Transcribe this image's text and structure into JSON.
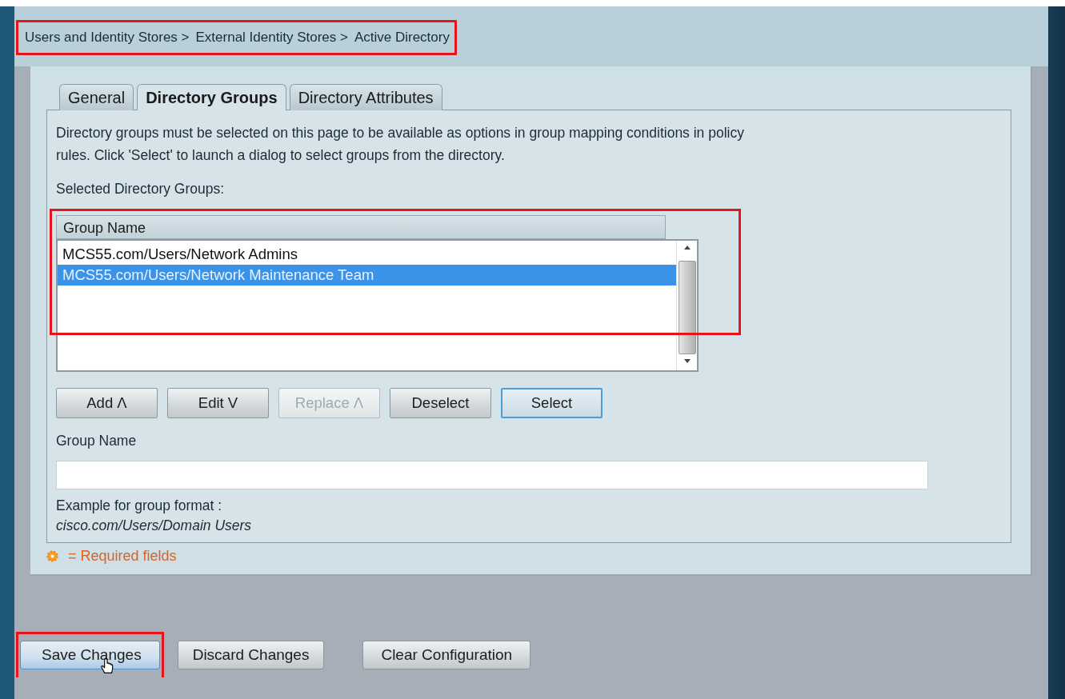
{
  "breadcrumb": {
    "items": [
      "Users and Identity Stores >",
      "External Identity Stores >",
      "Active Directory"
    ],
    "highlighted": true
  },
  "tabs": [
    {
      "label": "General",
      "selected": false
    },
    {
      "label": "Directory Groups",
      "selected": true
    },
    {
      "label": "Directory Attributes",
      "selected": false
    }
  ],
  "description": "Directory groups must be selected on this page to be available as options in group mapping conditions in policy rules. Click 'Select' to launch a dialog to select groups from the directory.",
  "selected_groups_label": "Selected Directory Groups:",
  "group_list": {
    "column": "Group Name",
    "highlighted": true,
    "rows": [
      {
        "text": "MCS55.com/Users/Network Admins",
        "selected": false
      },
      {
        "text": "MCS55.com/Users/Network Maintenance Team",
        "selected": true
      }
    ]
  },
  "list_buttons": [
    {
      "label": "Add Λ",
      "disabled": false,
      "focused": false
    },
    {
      "label": "Edit V",
      "disabled": false,
      "focused": false
    },
    {
      "label": "Replace Λ",
      "disabled": true,
      "focused": false
    },
    {
      "label": "Deselect",
      "disabled": false,
      "focused": false
    },
    {
      "label": "Select",
      "disabled": false,
      "focused": true
    }
  ],
  "group_name_field": {
    "label": "Group Name"
  },
  "example": {
    "label": "Example for group format :",
    "value": "cisco.com/Users/Domain Users"
  },
  "required_note": "= Required fields",
  "footer_buttons": [
    {
      "label": "Save Changes",
      "highlighted": true,
      "hovered": true
    },
    {
      "label": "Discard Changes",
      "highlighted": false,
      "hovered": false
    },
    {
      "label": "Clear Configuration",
      "highlighted": false,
      "hovered": false
    }
  ]
}
